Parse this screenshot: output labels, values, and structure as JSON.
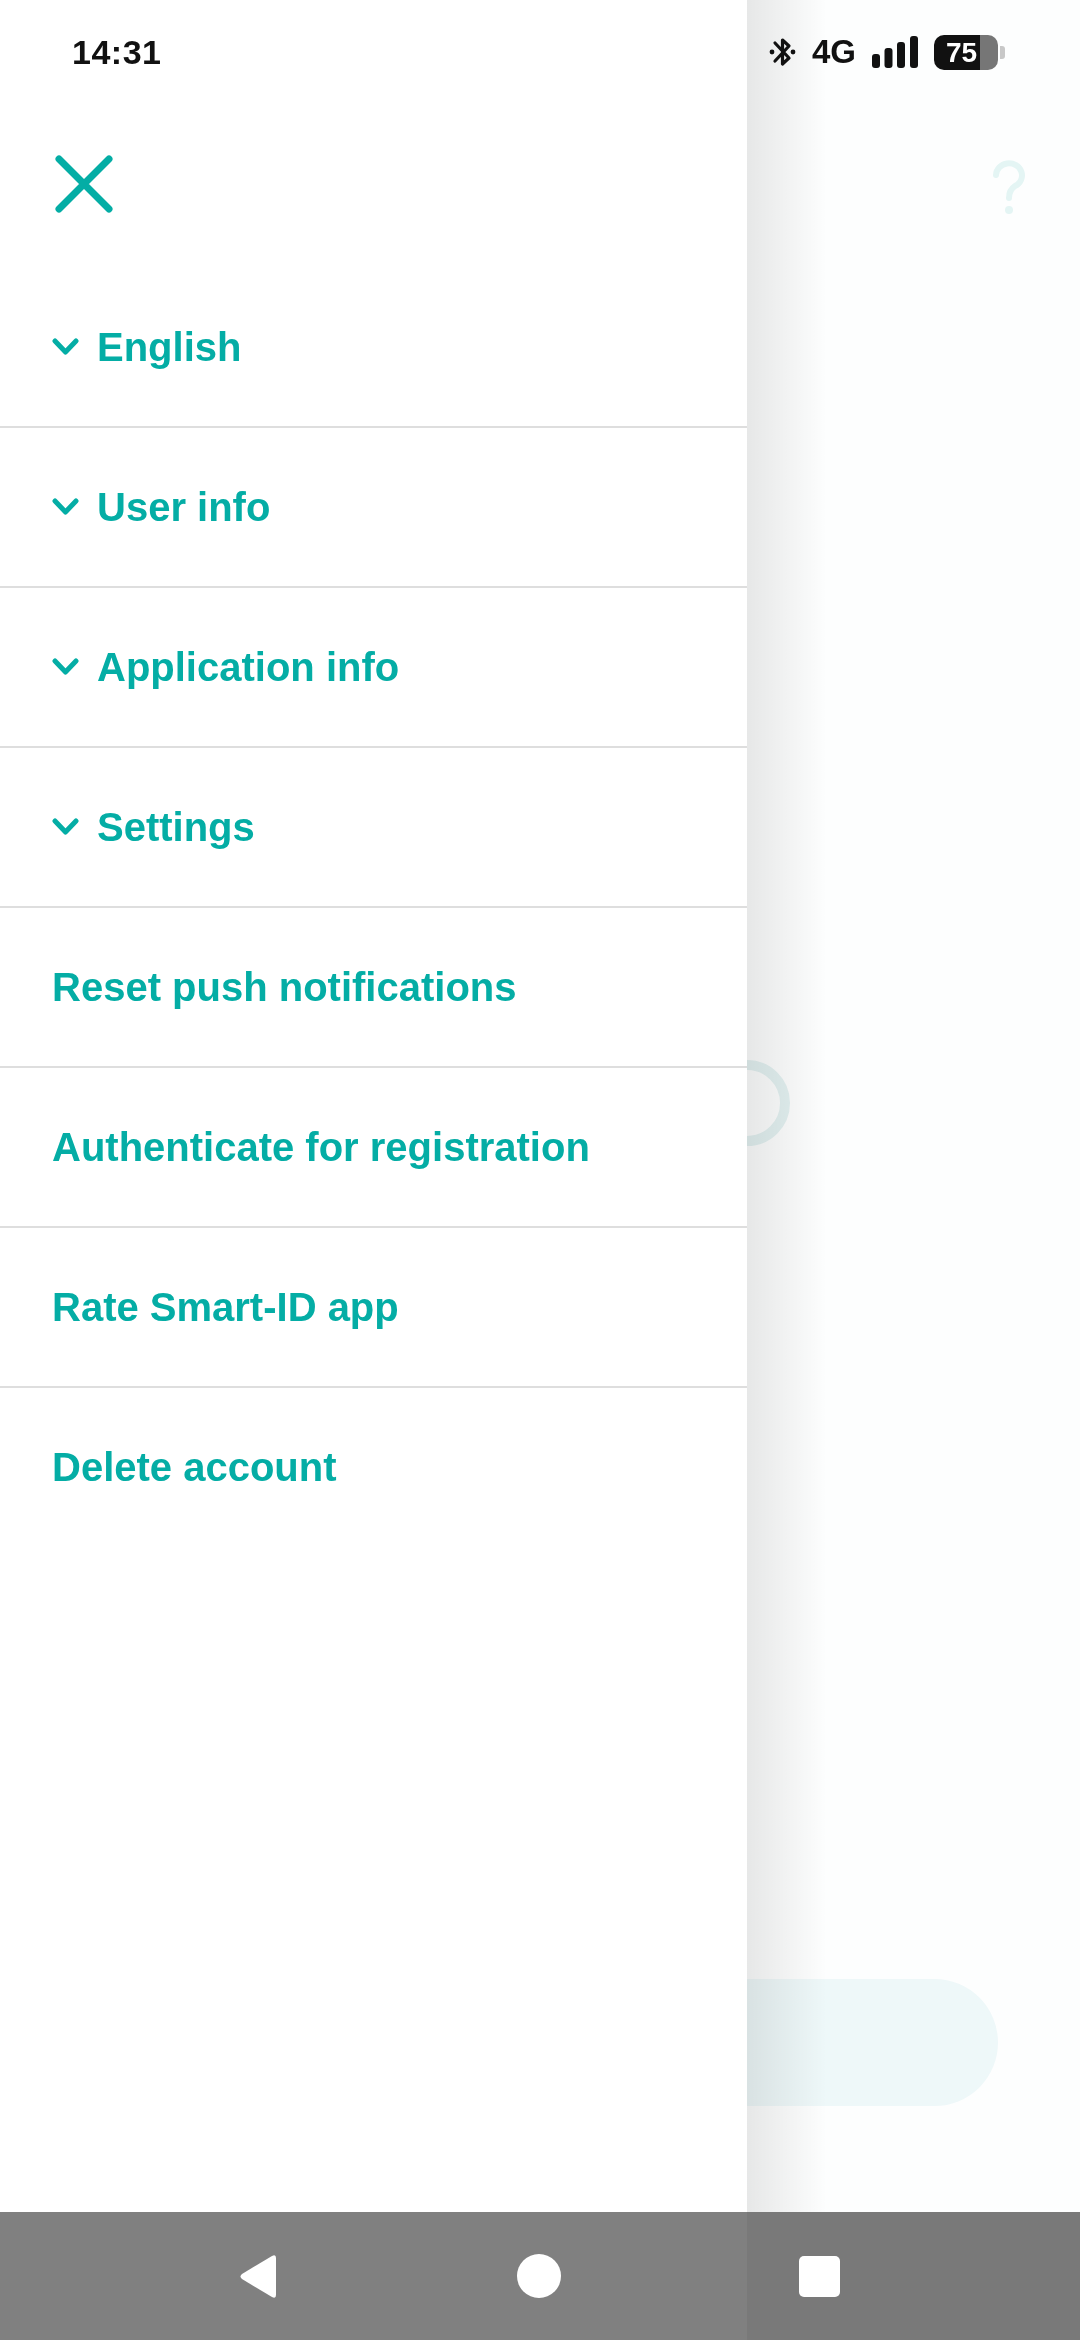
{
  "status_bar": {
    "time": "14:31",
    "network": "4G",
    "battery": "75"
  },
  "drawer": {
    "items": [
      {
        "label": "English",
        "kind": "expandable",
        "expanded": false
      },
      {
        "label": "User info",
        "kind": "expandable",
        "expanded": false
      },
      {
        "label": "Application info",
        "kind": "expandable",
        "expanded": false
      },
      {
        "label": "Settings",
        "kind": "expandable",
        "expanded": false
      },
      {
        "label": "Reset push notifications",
        "kind": "action"
      },
      {
        "label": "Authenticate for registration",
        "kind": "action"
      },
      {
        "label": "Rate Smart-ID app",
        "kind": "action"
      },
      {
        "label": "Delete account",
        "kind": "action"
      }
    ]
  }
}
